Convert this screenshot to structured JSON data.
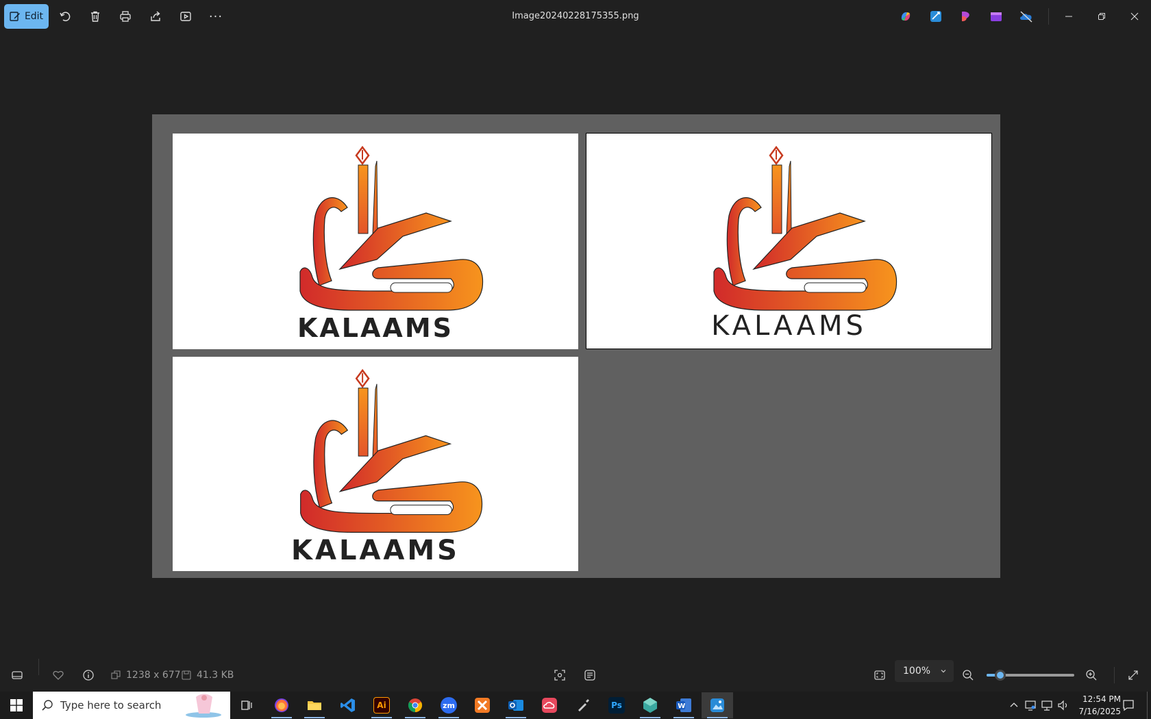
{
  "window": {
    "title": "Image20240228175355.png",
    "edit_label": "Edit"
  },
  "toolbar": {
    "more_label": "···"
  },
  "image": {
    "brand_text": "KALAAMS",
    "gradient_start": "#d12a2a",
    "gradient_end": "#f7941d"
  },
  "statusbar": {
    "dimensions": "1238 x 677",
    "file_size": "41.3 KB",
    "zoom_level": "100%",
    "zoom_fraction": 0.16
  },
  "taskbar": {
    "search_placeholder": "Type here to search",
    "time": "12:54 PM",
    "date": "7/16/2025"
  },
  "colors": {
    "accent": "#6cb6f0",
    "background": "#202020",
    "canvas": "#606060"
  }
}
